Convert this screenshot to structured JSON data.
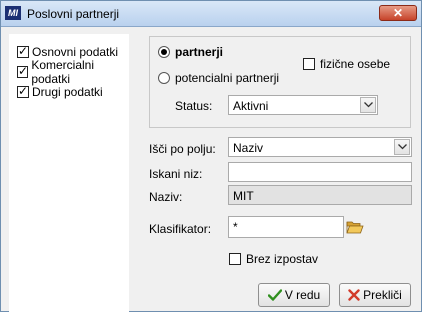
{
  "window": {
    "title": "Poslovni partnerji",
    "app_icon_text": "MI",
    "close_label": "✕"
  },
  "sidebar": {
    "items": [
      {
        "label": "Osnovni podatki",
        "checked": true
      },
      {
        "label": "Komercialni podatki",
        "checked": true
      },
      {
        "label": "Drugi podatki",
        "checked": true
      }
    ]
  },
  "partner_type": {
    "partnerji_label": "partnerji",
    "potencialni_label": "potencialni partnerji",
    "selected": "partnerji",
    "fizicne_label": "fizične osebe",
    "fizicne_checked": false,
    "status_label": "Status:",
    "status_value": "Aktivni"
  },
  "search": {
    "field_label": "Išči po polju:",
    "field_value": "Naziv",
    "term_label": "Iskani niz:",
    "term_value": "",
    "naziv_label": "Naziv:",
    "naziv_value": "MIT",
    "klasifikator_label": "Klasifikator:",
    "klasifikator_value": "*",
    "brez_label": "Brez izpostav",
    "brez_checked": false
  },
  "buttons": {
    "ok_label": "V redu",
    "cancel_label": "Prekliči"
  },
  "colors": {
    "ok_check": "#2f8f1e",
    "cancel_x": "#d23a2a",
    "folder": "#e6b84a"
  }
}
